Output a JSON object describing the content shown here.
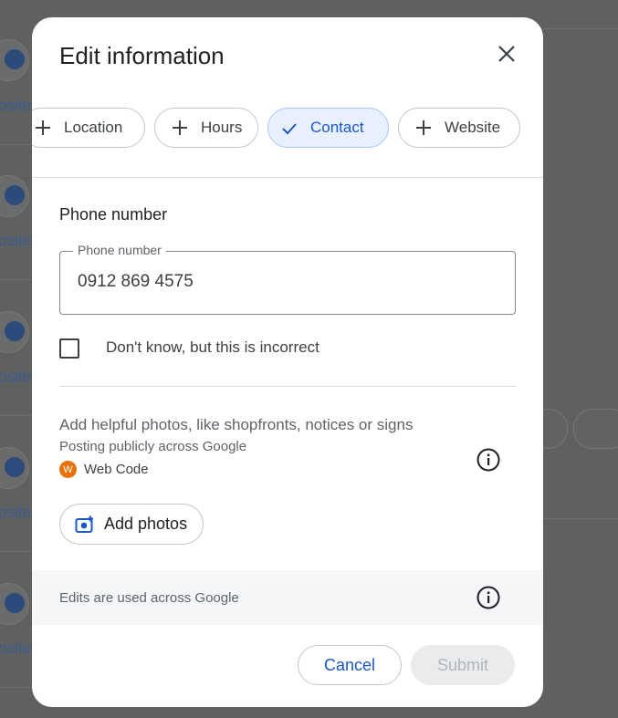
{
  "background": {
    "side_label": "osite"
  },
  "dialog": {
    "title": "Edit information",
    "chips": [
      {
        "label": "Location",
        "icon": "plus-icon",
        "selected": false
      },
      {
        "label": "Hours",
        "icon": "plus-icon",
        "selected": false
      },
      {
        "label": "Contact",
        "icon": "check-icon",
        "selected": true
      },
      {
        "label": "Website",
        "icon": "plus-icon",
        "selected": false
      }
    ],
    "phone_section": {
      "title": "Phone number",
      "field_label": "Phone number",
      "value": "0912 869 4575"
    },
    "checkbox_label": "Don't know, but this is incorrect",
    "photos": {
      "prompt": "Add helpful photos, like shopfronts, notices or signs",
      "posting_note": "Posting publicly across Google",
      "account_initial": "W",
      "account_name": "Web Code",
      "add_button": "Add photos"
    },
    "footer_note": "Edits are used across Google",
    "cancel_label": "Cancel",
    "submit_label": "Submit"
  },
  "colors": {
    "accent": "#1a57c7",
    "selected_chip_bg": "#e8f0fe",
    "avatar": "#e8710a"
  }
}
